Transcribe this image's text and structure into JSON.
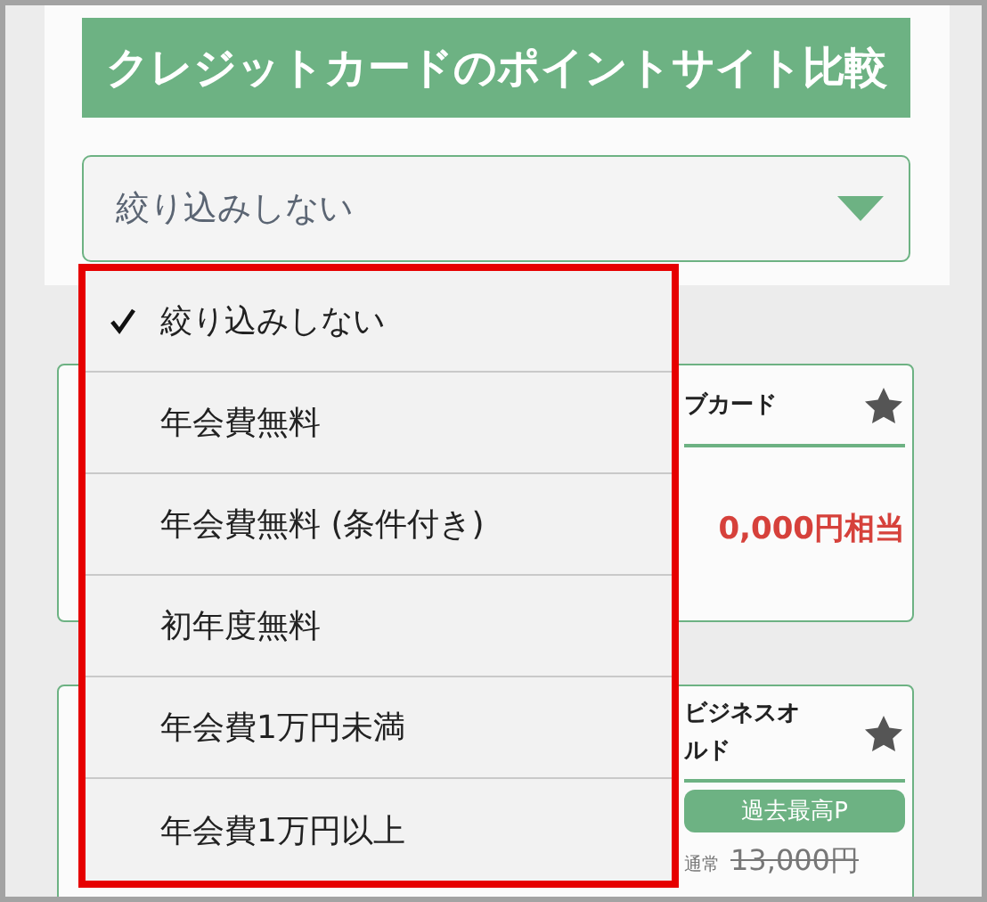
{
  "header": {
    "title": "クレジットカードのポイントサイト比較"
  },
  "filter": {
    "value": "絞り込みしない"
  },
  "menu": {
    "items": [
      {
        "label": "絞り込みしない",
        "selected": true
      },
      {
        "label": "年会費無料",
        "selected": false
      },
      {
        "label": "年会費無料 (条件付き)",
        "selected": false
      },
      {
        "label": "初年度無料",
        "selected": false
      },
      {
        "label": "年会費1万円未満",
        "selected": false
      },
      {
        "label": "年会費1万円以上",
        "selected": false
      }
    ]
  },
  "cards": [
    {
      "title_lines": [
        "ブカード"
      ],
      "price": "0,000円相当"
    },
    {
      "title_lines": [
        "ビジネスオ",
        "ルド"
      ],
      "badge": "過去最高P",
      "regular_label": "通常",
      "regular_price": "13,000円"
    }
  ]
}
